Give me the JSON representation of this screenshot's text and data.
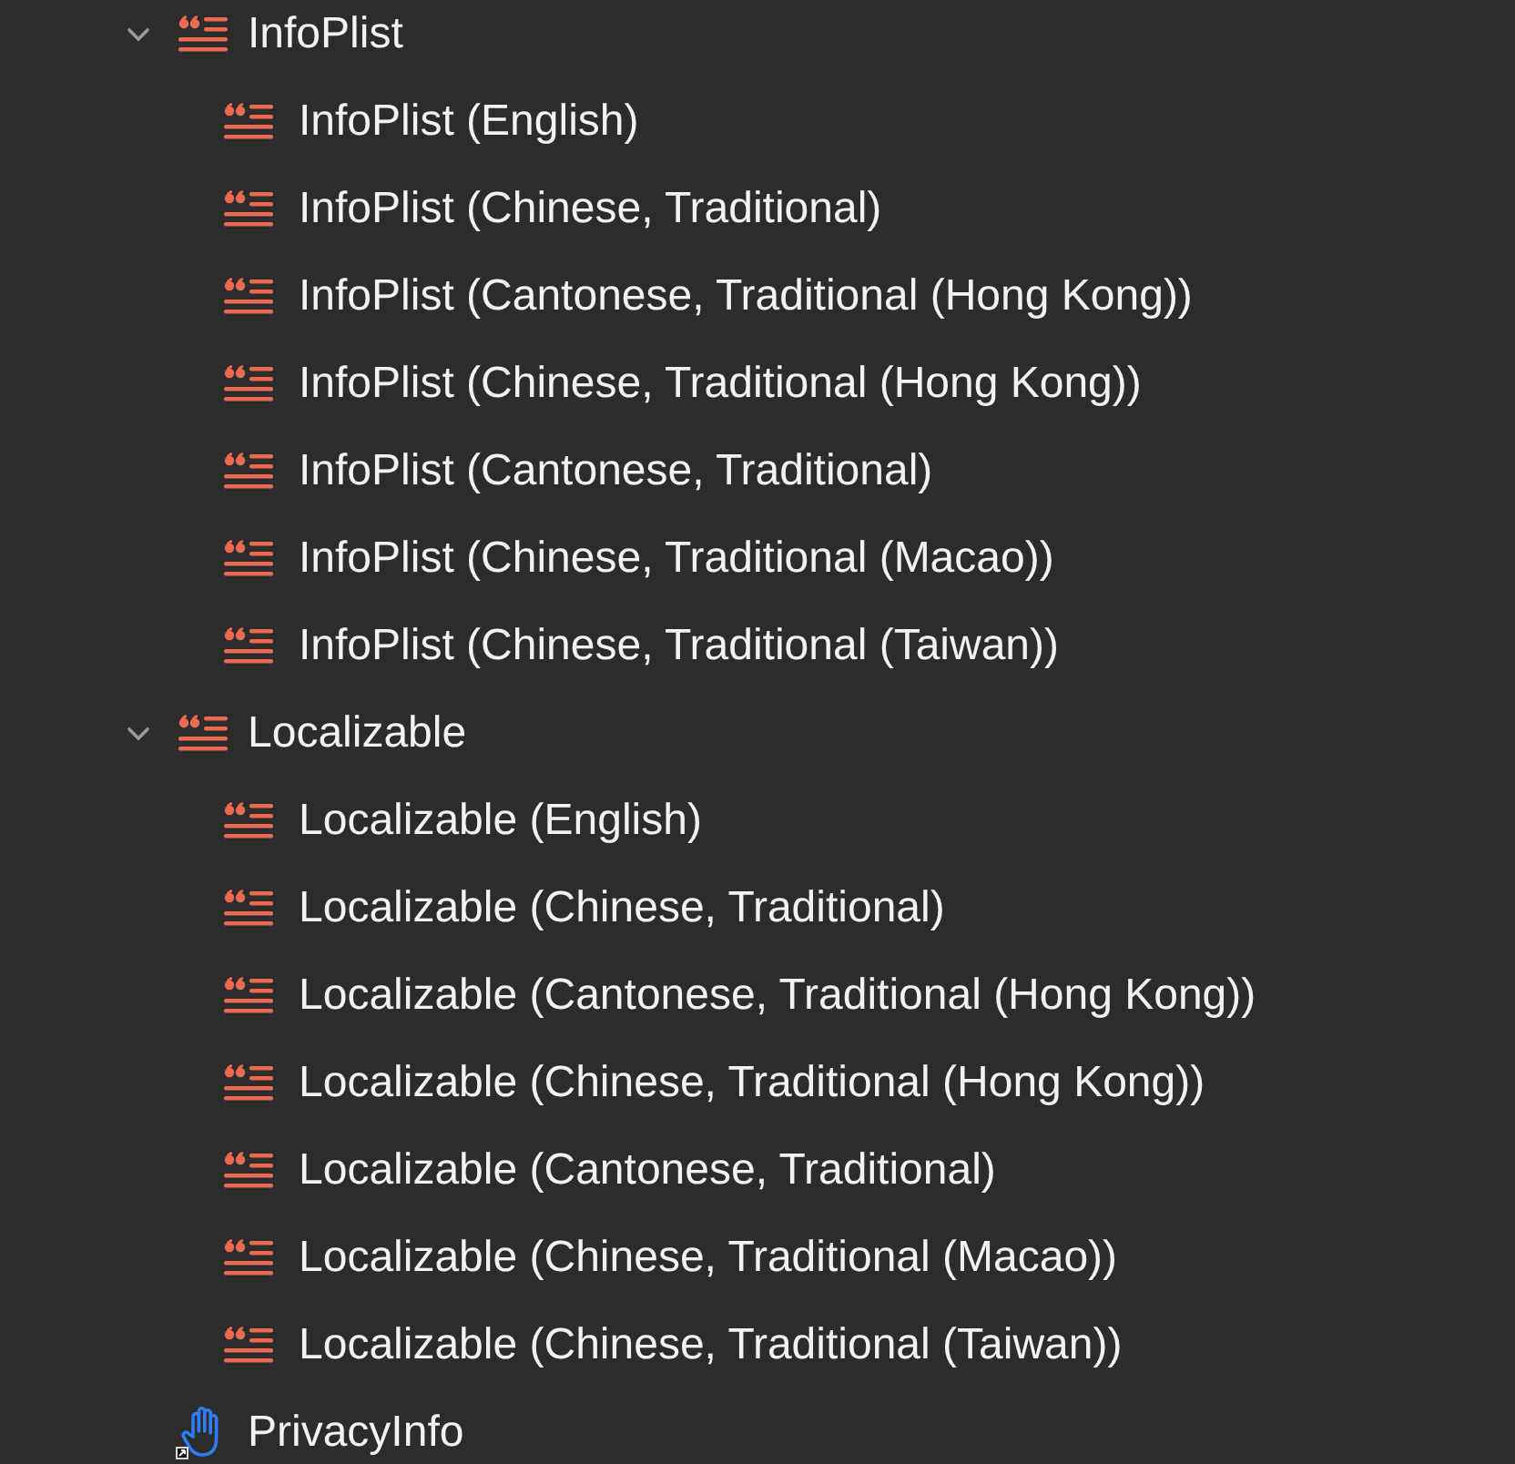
{
  "tree": [
    {
      "kind": "strings",
      "label": "InfoPlist",
      "expanded": true,
      "children": [
        {
          "kind": "strings",
          "label": "InfoPlist (English)"
        },
        {
          "kind": "strings",
          "label": "InfoPlist (Chinese, Traditional)"
        },
        {
          "kind": "strings",
          "label": "InfoPlist (Cantonese, Traditional (Hong Kong))"
        },
        {
          "kind": "strings",
          "label": "InfoPlist (Chinese, Traditional (Hong Kong))"
        },
        {
          "kind": "strings",
          "label": "InfoPlist (Cantonese, Traditional)"
        },
        {
          "kind": "strings",
          "label": "InfoPlist (Chinese, Traditional (Macao))"
        },
        {
          "kind": "strings",
          "label": "InfoPlist (Chinese, Traditional (Taiwan))"
        }
      ]
    },
    {
      "kind": "strings",
      "label": "Localizable",
      "expanded": true,
      "children": [
        {
          "kind": "strings",
          "label": "Localizable (English)"
        },
        {
          "kind": "strings",
          "label": "Localizable (Chinese, Traditional)"
        },
        {
          "kind": "strings",
          "label": "Localizable (Cantonese, Traditional (Hong Kong))"
        },
        {
          "kind": "strings",
          "label": "Localizable (Chinese, Traditional (Hong Kong))"
        },
        {
          "kind": "strings",
          "label": "Localizable (Cantonese, Traditional)"
        },
        {
          "kind": "strings",
          "label": "Localizable (Chinese, Traditional (Macao))"
        },
        {
          "kind": "strings",
          "label": "Localizable (Chinese, Traditional (Taiwan))"
        }
      ]
    },
    {
      "kind": "privacy",
      "label": "PrivacyInfo"
    }
  ]
}
